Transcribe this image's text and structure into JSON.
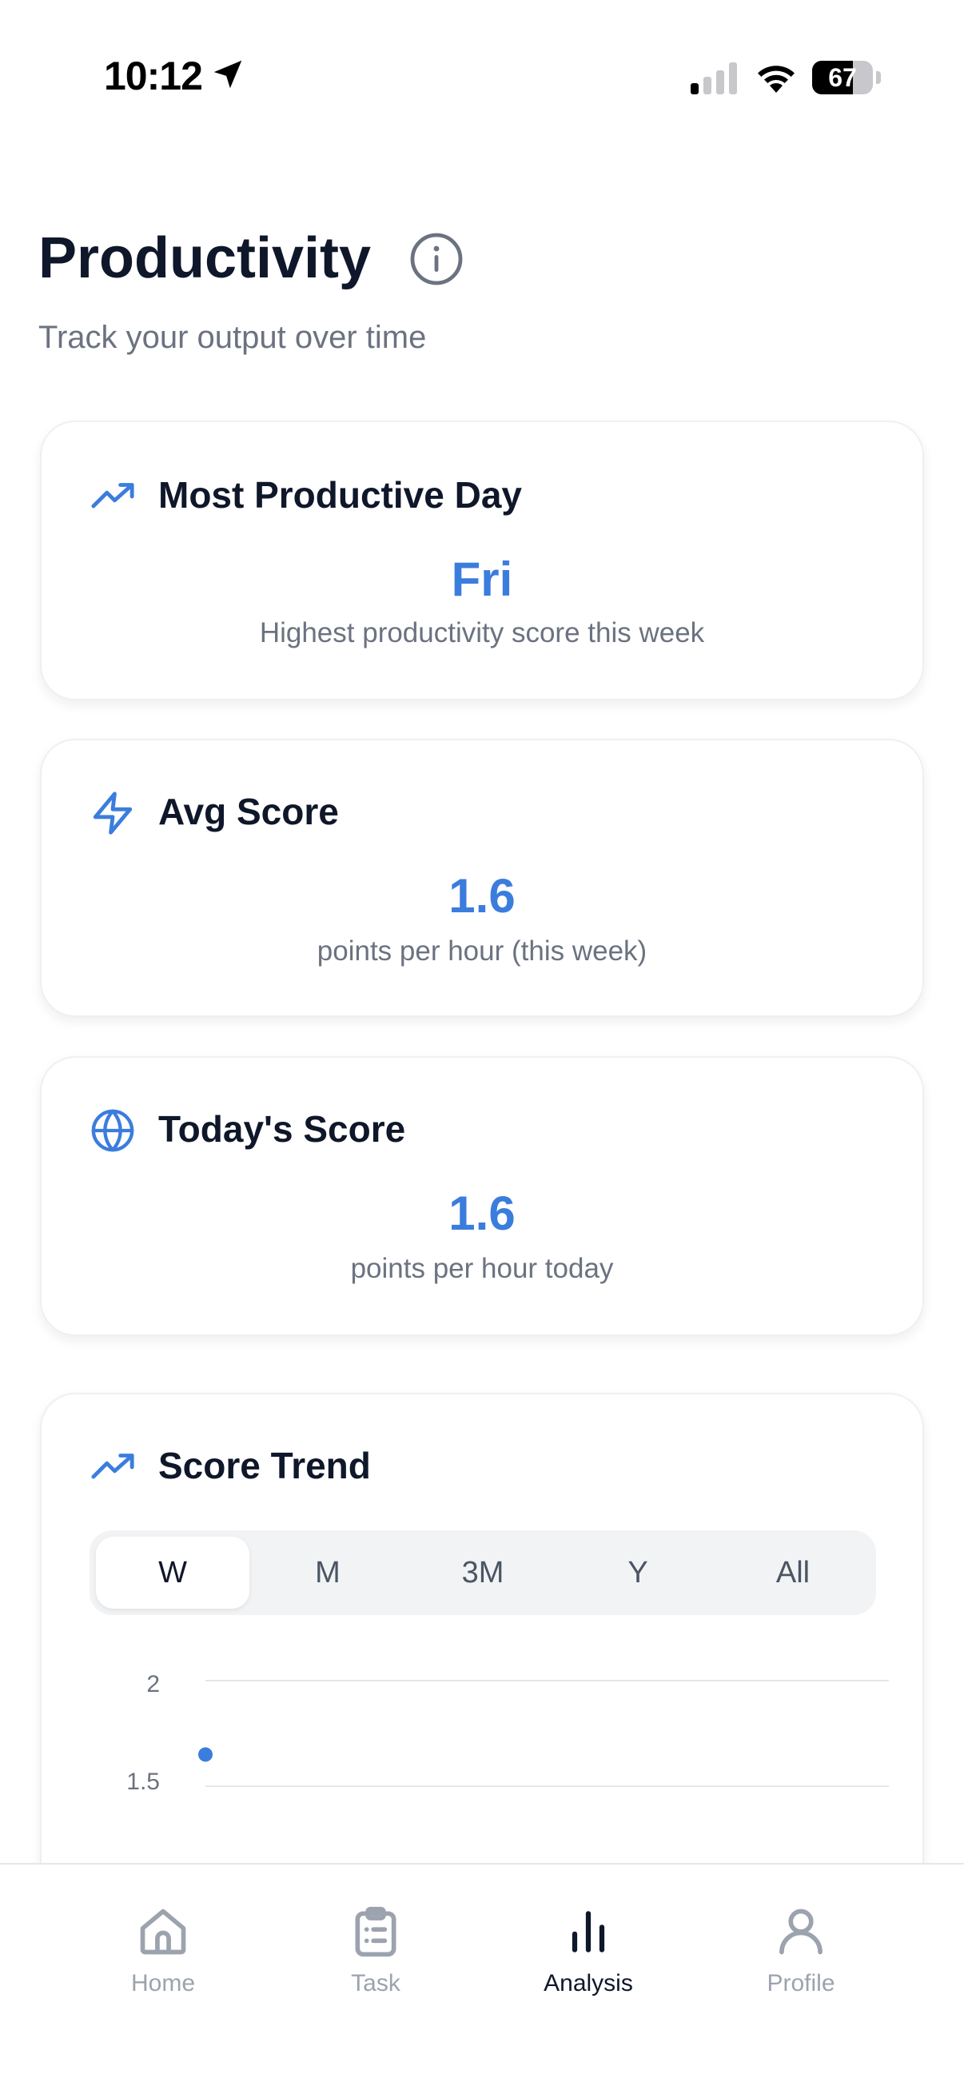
{
  "status_bar": {
    "time": "10:12",
    "battery": "67",
    "battery_level": 0.67
  },
  "header": {
    "title": "Productivity",
    "subtitle": "Track your output over time"
  },
  "cards": {
    "most_productive": {
      "icon": "trending-up-icon",
      "title": "Most Productive Day",
      "value": "Fri",
      "caption": "Highest productivity score this week"
    },
    "avg_score": {
      "icon": "lightning-icon",
      "title": "Avg Score",
      "value": "1.6",
      "caption": "points per hour (this week)"
    },
    "today_score": {
      "icon": "globe-icon",
      "title": "Today's Score",
      "value": "1.6",
      "caption": "points per hour today"
    }
  },
  "score_trend": {
    "icon": "trending-up-icon",
    "title": "Score Trend",
    "ranges": [
      "W",
      "M",
      "3M",
      "Y",
      "All"
    ],
    "selected_range": "W"
  },
  "chart_data": {
    "type": "scatter",
    "title": "",
    "xlabel": "",
    "ylabel": "",
    "y_ticks": [
      "2",
      "1.5"
    ],
    "ylim": [
      1.5,
      2
    ],
    "grid": true,
    "series": [
      {
        "values": [
          1.65
        ]
      }
    ],
    "accent_color": "#3b7ddd"
  },
  "bottom_nav": {
    "items": [
      {
        "label": "Home",
        "icon": "home-icon"
      },
      {
        "label": "Task",
        "icon": "clipboard-icon"
      },
      {
        "label": "Analysis",
        "icon": "bar-chart-icon"
      },
      {
        "label": "Profile",
        "icon": "user-icon"
      }
    ],
    "active": "Analysis"
  }
}
